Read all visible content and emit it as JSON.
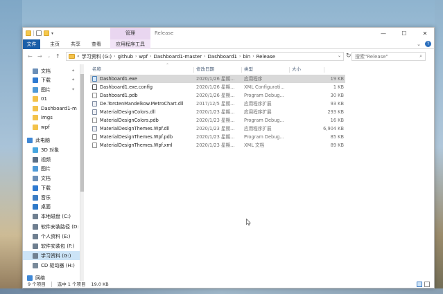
{
  "window": {
    "title": "Release",
    "manage_tab": "管理",
    "min": "—",
    "max": "☐",
    "close": "✕"
  },
  "ribbon": {
    "tabs": [
      "文件",
      "主页",
      "共享",
      "查看",
      "应用程序工具"
    ],
    "expand": "⌄"
  },
  "address": {
    "prefix": "«",
    "segments": [
      "学习资料 (G:)",
      "github",
      "wpf",
      "Dashboard1-master",
      "Dashboard1",
      "bin",
      "Release"
    ],
    "search_placeholder": "搜索\"Release\""
  },
  "nav_pane": {
    "items": [
      {
        "label": "文档",
        "icon": "documents-icon",
        "color": "#6b8fb8",
        "pinned": true
      },
      {
        "label": "下载",
        "icon": "download-icon",
        "color": "#2f7ad1",
        "pinned": true
      },
      {
        "label": "图片",
        "icon": "pictures-icon",
        "color": "#4f9ad8",
        "pinned": true
      },
      {
        "label": "01",
        "icon": "folder-icon",
        "color": "#f3c24a",
        "pinned": false
      },
      {
        "label": "Dashboard1-m",
        "icon": "folder-icon",
        "color": "#f3c24a",
        "pinned": false
      },
      {
        "label": "imgs",
        "icon": "folder-icon",
        "color": "#f3c24a",
        "pinned": false
      },
      {
        "label": "wpf",
        "icon": "folder-icon",
        "color": "#f3c24a",
        "pinned": false
      },
      {
        "label": "此电脑",
        "icon": "computer-icon",
        "color": "#3f88d6",
        "pinned": false
      },
      {
        "label": "3D 对象",
        "icon": "3d-objects-icon",
        "color": "#46a6e0",
        "pinned": false
      },
      {
        "label": "视频",
        "icon": "videos-icon",
        "color": "#5b6f86",
        "pinned": false
      },
      {
        "label": "图片",
        "icon": "pictures-icon",
        "color": "#4f9ad8",
        "pinned": false
      },
      {
        "label": "文档",
        "icon": "documents-icon",
        "color": "#6b8fb8",
        "pinned": false
      },
      {
        "label": "下载",
        "icon": "download-icon",
        "color": "#2f7ad1",
        "pinned": false
      },
      {
        "label": "音乐",
        "icon": "music-icon",
        "color": "#3c7dc4",
        "pinned": false
      },
      {
        "label": "桌面",
        "icon": "desktop-icon",
        "color": "#2e79c9",
        "pinned": false
      },
      {
        "label": "本地磁盘 (C:)",
        "icon": "drive-icon",
        "color": "#6f7f90",
        "pinned": false
      },
      {
        "label": "软件安装路径 (D:",
        "icon": "drive-icon",
        "color": "#6f7f90",
        "pinned": false
      },
      {
        "label": "个人资料 (E:)",
        "icon": "drive-icon",
        "color": "#6f7f90",
        "pinned": false
      },
      {
        "label": "软件安装包 (F:)",
        "icon": "drive-icon",
        "color": "#6f7f90",
        "pinned": false
      },
      {
        "label": "学习资料 (G:)",
        "icon": "drive-icon",
        "color": "#6f7f90",
        "pinned": false,
        "selected": true
      },
      {
        "label": "CD 驱动器 (H:)",
        "icon": "cd-drive-icon",
        "color": "#7a8a9a",
        "pinned": false
      },
      {
        "label": "网络",
        "icon": "network-icon",
        "color": "#3f88d6",
        "pinned": false
      }
    ]
  },
  "columns": {
    "name": "名称",
    "date": "修改日期",
    "type": "类型",
    "size": "大小"
  },
  "files": [
    {
      "name": "Dashboard1.exe",
      "date": "2020/1/26 星期...",
      "type": "应用程序",
      "size": "19 KB",
      "icon": "exe",
      "selected": true
    },
    {
      "name": "Dashboard1.exe.config",
      "date": "2020/1/26 星期...",
      "type": "XML Configurati...",
      "size": "1 KB",
      "icon": "cfg"
    },
    {
      "name": "Dashboard1.pdb",
      "date": "2020/1/26 星期...",
      "type": "Program Debug...",
      "size": "30 KB",
      "icon": "doc"
    },
    {
      "name": "De.TorstenMandelkow.MetroChart.dll",
      "date": "2017/12/5 星期...",
      "type": "应用程序扩展",
      "size": "93 KB",
      "icon": "dll"
    },
    {
      "name": "MaterialDesignColors.dll",
      "date": "2020/1/23 星期...",
      "type": "应用程序扩展",
      "size": "293 KB",
      "icon": "dll"
    },
    {
      "name": "MaterialDesignColors.pdb",
      "date": "2020/1/23 星期...",
      "type": "Program Debug...",
      "size": "16 KB",
      "icon": "doc"
    },
    {
      "name": "MaterialDesignThemes.Wpf.dll",
      "date": "2020/1/23 星期...",
      "type": "应用程序扩展",
      "size": "6,904 KB",
      "icon": "dll"
    },
    {
      "name": "MaterialDesignThemes.Wpf.pdb",
      "date": "2020/1/23 星期...",
      "type": "Program Debug...",
      "size": "85 KB",
      "icon": "doc"
    },
    {
      "name": "MaterialDesignThemes.Wpf.xml",
      "date": "2020/1/23 星期...",
      "type": "XML 文档",
      "size": "89 KB",
      "icon": "doc"
    }
  ],
  "status": {
    "count": "9 个项目",
    "selected": "选中 1 个项目",
    "selected_size": "19.0 KB"
  }
}
